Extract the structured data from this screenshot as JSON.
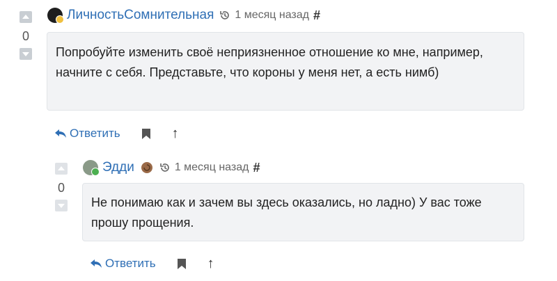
{
  "comments": [
    {
      "votes": "0",
      "author": "ЛичностьСомнительная",
      "time": "1 месяц назад",
      "hash": "#",
      "text": "Попробуйте изменить своё неприязненное отношение ко мне, например, начните с себя. Представьте, что короны у меня нет, а есть нимб)",
      "reply_label": "Ответить"
    },
    {
      "votes": "0",
      "author": "Эдди",
      "time": "1 месяц назад",
      "hash": "#",
      "text": "Не понимаю как и зачем вы здесь оказались, но ладно) У вас тоже прошу прощения.",
      "reply_label": "Ответить"
    }
  ],
  "colors": {
    "link": "#2f6fb5",
    "online": "#4caf50",
    "vote_button": "#c9ced3"
  }
}
